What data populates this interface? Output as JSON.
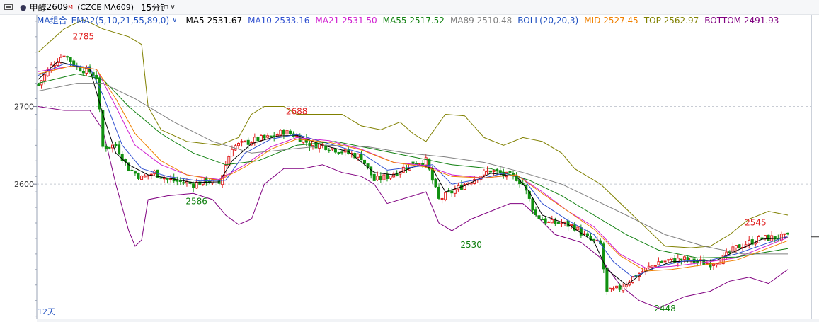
{
  "header": {
    "bullet": "●",
    "name": "甲醇",
    "code_num": "2609",
    "code_sup": "M",
    "exchange": "(CZCE MA609)",
    "period": "15分钟",
    "chevron": "∨"
  },
  "legend": {
    "indicator": "MA组合_EMA2(5,10,21,55,89,0)",
    "chevron": "∨",
    "items": [
      {
        "label": "MA5 2531.67",
        "color": "#000000"
      },
      {
        "label": "MA10 2533.16",
        "color": "#3050d0"
      },
      {
        "label": "MA21 2531.50",
        "color": "#d020d0"
      },
      {
        "label": "MA55 2517.52",
        "color": "#108010"
      },
      {
        "label": "MA89 2510.48",
        "color": "#808080"
      },
      {
        "label": "BOLL(20,20,3)",
        "color": "#2050c0"
      },
      {
        "label": "MID 2527.45",
        "color": "#f08000"
      },
      {
        "label": "TOP 2562.97",
        "color": "#808000"
      },
      {
        "label": "BOTTOM 2491.93",
        "color": "#800080"
      }
    ]
  },
  "chart_data": {
    "type": "candlestick",
    "y_ticks": [
      2700,
      2600
    ],
    "ylim": [
      2426,
      2819
    ],
    "grid": "horizontal-dashed",
    "bottom_label": "12天",
    "annotations": [
      {
        "label": "2785",
        "price": 2785,
        "kind": "high"
      },
      {
        "label": "2688",
        "price": 2688,
        "kind": "high"
      },
      {
        "label": "2586",
        "price": 2586,
        "kind": "low"
      },
      {
        "label": "2530",
        "price": 2530,
        "kind": "low"
      },
      {
        "label": "2448",
        "price": 2448,
        "kind": "low"
      },
      {
        "label": "2545",
        "price": 2545,
        "kind": "high"
      }
    ],
    "close_path": [
      [
        0,
        2728
      ],
      [
        4,
        2752
      ],
      [
        8,
        2768
      ],
      [
        12,
        2750
      ],
      [
        16,
        2745
      ],
      [
        18,
        2738
      ],
      [
        20,
        2648
      ],
      [
        24,
        2650
      ],
      [
        28,
        2620
      ],
      [
        32,
        2608
      ],
      [
        36,
        2615
      ],
      [
        40,
        2606
      ],
      [
        44,
        2603
      ],
      [
        48,
        2600
      ],
      [
        52,
        2605
      ],
      [
        56,
        2601
      ],
      [
        60,
        2648
      ],
      [
        64,
        2653
      ],
      [
        68,
        2658
      ],
      [
        72,
        2660
      ],
      [
        76,
        2668
      ],
      [
        80,
        2662
      ],
      [
        84,
        2652
      ],
      [
        88,
        2650
      ],
      [
        92,
        2645
      ],
      [
        96,
        2640
      ],
      [
        100,
        2635
      ],
      [
        104,
        2605
      ],
      [
        108,
        2610
      ],
      [
        112,
        2618
      ],
      [
        116,
        2628
      ],
      [
        120,
        2630
      ],
      [
        124,
        2580
      ],
      [
        128,
        2590
      ],
      [
        132,
        2600
      ],
      [
        136,
        2610
      ],
      [
        140,
        2618
      ],
      [
        144,
        2612
      ],
      [
        148,
        2608
      ],
      [
        150,
        2600
      ],
      [
        154,
        2560
      ],
      [
        158,
        2550
      ],
      [
        162,
        2550
      ],
      [
        166,
        2545
      ],
      [
        170,
        2530
      ],
      [
        174,
        2522
      ],
      [
        176,
        2460
      ],
      [
        180,
        2466
      ],
      [
        184,
        2480
      ],
      [
        188,
        2490
      ],
      [
        192,
        2500
      ],
      [
        196,
        2502
      ],
      [
        200,
        2503
      ],
      [
        204,
        2500
      ],
      [
        208,
        2498
      ],
      [
        212,
        2505
      ],
      [
        216,
        2518
      ],
      [
        220,
        2525
      ],
      [
        224,
        2530
      ],
      [
        228,
        2531
      ],
      [
        232,
        2532
      ]
    ],
    "series": [
      {
        "name": "MA5",
        "color": "#000000",
        "points": [
          [
            0,
            2735
          ],
          [
            6,
            2758
          ],
          [
            12,
            2752
          ],
          [
            16,
            2748
          ],
          [
            20,
            2690
          ],
          [
            24,
            2640
          ],
          [
            28,
            2625
          ],
          [
            34,
            2612
          ],
          [
            40,
            2608
          ],
          [
            48,
            2602
          ],
          [
            56,
            2603
          ],
          [
            60,
            2630
          ],
          [
            66,
            2652
          ],
          [
            74,
            2662
          ],
          [
            80,
            2663
          ],
          [
            88,
            2650
          ],
          [
            96,
            2642
          ],
          [
            104,
            2615
          ],
          [
            110,
            2612
          ],
          [
            118,
            2625
          ],
          [
            122,
            2620
          ],
          [
            126,
            2590
          ],
          [
            132,
            2598
          ],
          [
            140,
            2614
          ],
          [
            148,
            2610
          ],
          [
            152,
            2590
          ],
          [
            156,
            2560
          ],
          [
            164,
            2548
          ],
          [
            172,
            2526
          ],
          [
            176,
            2490
          ],
          [
            182,
            2470
          ],
          [
            188,
            2488
          ],
          [
            196,
            2500
          ],
          [
            204,
            2501
          ],
          [
            210,
            2502
          ],
          [
            216,
            2514
          ],
          [
            224,
            2529
          ],
          [
            232,
            2531
          ]
        ]
      },
      {
        "name": "MA10",
        "color": "#3050d0",
        "points": [
          [
            0,
            2740
          ],
          [
            8,
            2755
          ],
          [
            16,
            2750
          ],
          [
            20,
            2715
          ],
          [
            26,
            2650
          ],
          [
            32,
            2620
          ],
          [
            40,
            2610
          ],
          [
            50,
            2604
          ],
          [
            58,
            2605
          ],
          [
            64,
            2640
          ],
          [
            72,
            2658
          ],
          [
            80,
            2664
          ],
          [
            90,
            2652
          ],
          [
            100,
            2640
          ],
          [
            108,
            2618
          ],
          [
            116,
            2622
          ],
          [
            122,
            2625
          ],
          [
            128,
            2600
          ],
          [
            136,
            2606
          ],
          [
            144,
            2614
          ],
          [
            150,
            2608
          ],
          [
            156,
            2575
          ],
          [
            164,
            2553
          ],
          [
            172,
            2535
          ],
          [
            178,
            2500
          ],
          [
            184,
            2480
          ],
          [
            192,
            2494
          ],
          [
            200,
            2501
          ],
          [
            208,
            2502
          ],
          [
            216,
            2510
          ],
          [
            232,
            2533
          ]
        ]
      },
      {
        "name": "MA21",
        "color": "#d020d0",
        "points": [
          [
            0,
            2745
          ],
          [
            10,
            2752
          ],
          [
            18,
            2748
          ],
          [
            24,
            2700
          ],
          [
            30,
            2650
          ],
          [
            38,
            2625
          ],
          [
            46,
            2612
          ],
          [
            56,
            2606
          ],
          [
            64,
            2625
          ],
          [
            72,
            2648
          ],
          [
            80,
            2660
          ],
          [
            90,
            2656
          ],
          [
            100,
            2645
          ],
          [
            110,
            2628
          ],
          [
            120,
            2624
          ],
          [
            128,
            2612
          ],
          [
            138,
            2608
          ],
          [
            148,
            2612
          ],
          [
            156,
            2590
          ],
          [
            164,
            2565
          ],
          [
            172,
            2545
          ],
          [
            180,
            2510
          ],
          [
            188,
            2492
          ],
          [
            196,
            2494
          ],
          [
            206,
            2499
          ],
          [
            216,
            2505
          ],
          [
            232,
            2531
          ]
        ]
      },
      {
        "name": "MA55",
        "color": "#108010",
        "points": [
          [
            0,
            2730
          ],
          [
            12,
            2742
          ],
          [
            20,
            2735
          ],
          [
            28,
            2700
          ],
          [
            38,
            2665
          ],
          [
            48,
            2640
          ],
          [
            58,
            2625
          ],
          [
            68,
            2630
          ],
          [
            80,
            2650
          ],
          [
            92,
            2655
          ],
          [
            104,
            2645
          ],
          [
            116,
            2635
          ],
          [
            128,
            2625
          ],
          [
            140,
            2620
          ],
          [
            152,
            2605
          ],
          [
            162,
            2585
          ],
          [
            172,
            2560
          ],
          [
            182,
            2535
          ],
          [
            192,
            2515
          ],
          [
            204,
            2505
          ],
          [
            216,
            2506
          ],
          [
            232,
            2517
          ]
        ]
      },
      {
        "name": "MA89",
        "color": "#808080",
        "points": [
          [
            0,
            2720
          ],
          [
            12,
            2730
          ],
          [
            20,
            2730
          ],
          [
            30,
            2710
          ],
          [
            42,
            2680
          ],
          [
            54,
            2655
          ],
          [
            66,
            2640
          ],
          [
            78,
            2645
          ],
          [
            90,
            2650
          ],
          [
            102,
            2648
          ],
          [
            114,
            2640
          ],
          [
            126,
            2635
          ],
          [
            138,
            2628
          ],
          [
            150,
            2615
          ],
          [
            162,
            2600
          ],
          [
            172,
            2580
          ],
          [
            182,
            2560
          ],
          [
            194,
            2535
          ],
          [
            206,
            2520
          ],
          [
            218,
            2510
          ],
          [
            232,
            2510
          ]
        ]
      },
      {
        "name": "MID",
        "color": "#f08000",
        "points": [
          [
            0,
            2742
          ],
          [
            10,
            2752
          ],
          [
            18,
            2748
          ],
          [
            24,
            2710
          ],
          [
            30,
            2665
          ],
          [
            38,
            2630
          ],
          [
            46,
            2612
          ],
          [
            56,
            2605
          ],
          [
            64,
            2622
          ],
          [
            72,
            2645
          ],
          [
            80,
            2658
          ],
          [
            90,
            2654
          ],
          [
            100,
            2644
          ],
          [
            110,
            2628
          ],
          [
            120,
            2622
          ],
          [
            128,
            2610
          ],
          [
            138,
            2608
          ],
          [
            148,
            2612
          ],
          [
            156,
            2588
          ],
          [
            164,
            2565
          ],
          [
            172,
            2542
          ],
          [
            180,
            2508
          ],
          [
            188,
            2488
          ],
          [
            196,
            2490
          ],
          [
            206,
            2496
          ],
          [
            216,
            2502
          ],
          [
            232,
            2527
          ]
        ]
      },
      {
        "name": "TOP",
        "color": "#808000",
        "points": [
          [
            0,
            2770
          ],
          [
            8,
            2800
          ],
          [
            14,
            2812
          ],
          [
            20,
            2800
          ],
          [
            28,
            2790
          ],
          [
            32,
            2780
          ],
          [
            34,
            2700
          ],
          [
            38,
            2670
          ],
          [
            46,
            2655
          ],
          [
            56,
            2650
          ],
          [
            62,
            2660
          ],
          [
            66,
            2690
          ],
          [
            70,
            2700
          ],
          [
            76,
            2700
          ],
          [
            80,
            2690
          ],
          [
            88,
            2690
          ],
          [
            94,
            2690
          ],
          [
            100,
            2675
          ],
          [
            106,
            2670
          ],
          [
            112,
            2680
          ],
          [
            116,
            2665
          ],
          [
            120,
            2655
          ],
          [
            126,
            2690
          ],
          [
            132,
            2688
          ],
          [
            138,
            2660
          ],
          [
            144,
            2650
          ],
          [
            150,
            2660
          ],
          [
            156,
            2655
          ],
          [
            162,
            2640
          ],
          [
            166,
            2620
          ],
          [
            174,
            2600
          ],
          [
            184,
            2560
          ],
          [
            194,
            2520
          ],
          [
            202,
            2518
          ],
          [
            208,
            2520
          ],
          [
            214,
            2535
          ],
          [
            220,
            2555
          ],
          [
            226,
            2565
          ],
          [
            232,
            2560
          ]
        ]
      },
      {
        "name": "BOTTOM",
        "color": "#800080",
        "points": [
          [
            0,
            2700
          ],
          [
            8,
            2695
          ],
          [
            16,
            2695
          ],
          [
            20,
            2670
          ],
          [
            24,
            2600
          ],
          [
            28,
            2540
          ],
          [
            30,
            2520
          ],
          [
            32,
            2528
          ],
          [
            34,
            2580
          ],
          [
            40,
            2585
          ],
          [
            48,
            2588
          ],
          [
            54,
            2580
          ],
          [
            58,
            2560
          ],
          [
            62,
            2548
          ],
          [
            66,
            2555
          ],
          [
            70,
            2600
          ],
          [
            76,
            2620
          ],
          [
            82,
            2620
          ],
          [
            88,
            2625
          ],
          [
            94,
            2615
          ],
          [
            100,
            2610
          ],
          [
            104,
            2600
          ],
          [
            108,
            2575
          ],
          [
            116,
            2585
          ],
          [
            120,
            2590
          ],
          [
            124,
            2550
          ],
          [
            128,
            2540
          ],
          [
            134,
            2555
          ],
          [
            140,
            2565
          ],
          [
            146,
            2575
          ],
          [
            150,
            2575
          ],
          [
            154,
            2560
          ],
          [
            160,
            2535
          ],
          [
            168,
            2525
          ],
          [
            174,
            2505
          ],
          [
            180,
            2470
          ],
          [
            186,
            2450
          ],
          [
            192,
            2440
          ],
          [
            200,
            2455
          ],
          [
            208,
            2462
          ],
          [
            214,
            2475
          ],
          [
            220,
            2480
          ],
          [
            226,
            2472
          ],
          [
            232,
            2490
          ]
        ]
      }
    ]
  }
}
